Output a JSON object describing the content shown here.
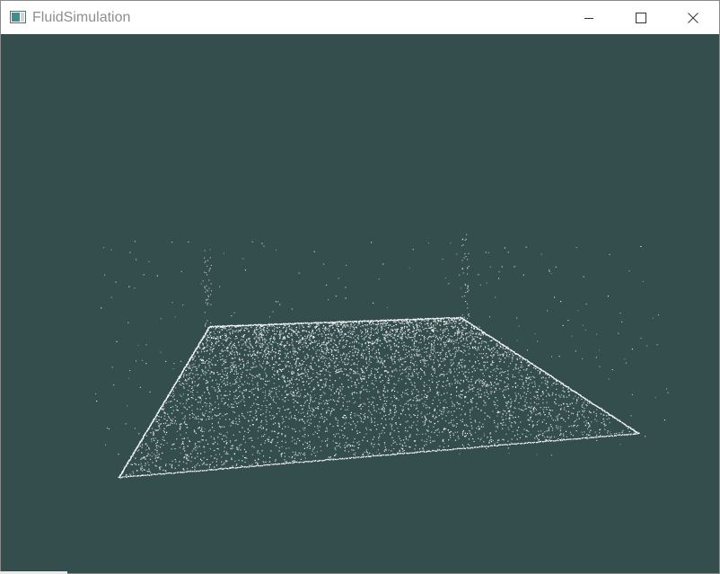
{
  "window": {
    "title": "FluidSimulation",
    "icon": "app-window-icon"
  },
  "caption_buttons": {
    "minimize_icon": "minimize-icon",
    "maximize_icon": "maximize-icon",
    "close_icon": "close-icon"
  },
  "viewport": {
    "background_color": "#344d4d",
    "particle_color": "#ffffff",
    "content": "particle-cloud"
  }
}
